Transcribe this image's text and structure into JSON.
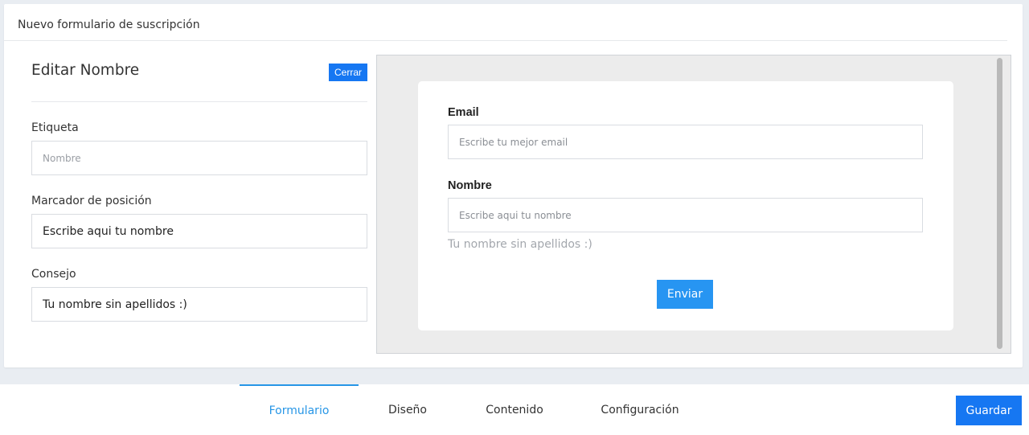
{
  "header": {
    "title": "Nuevo formulario de suscripción"
  },
  "editor": {
    "title": "Editar Nombre",
    "close_label": "Cerrar",
    "fields": [
      {
        "label": "Etiqueta",
        "value": "",
        "placeholder": "Nombre"
      },
      {
        "label": "Marcador de posición",
        "value": "Escribe aqui tu nombre",
        "placeholder": ""
      },
      {
        "label": "Consejo",
        "value": "Tu nombre sin apellidos :)",
        "placeholder": ""
      }
    ]
  },
  "preview": {
    "email_label": "Email",
    "email_placeholder": "Escribe tu mejor email",
    "name_label": "Nombre",
    "name_placeholder": "Escribe aqui tu nombre",
    "name_hint": "Tu nombre sin apellidos :)",
    "submit_label": "Enviar"
  },
  "tabs": [
    {
      "label": "Formulario",
      "active": true
    },
    {
      "label": "Diseño",
      "active": false
    },
    {
      "label": "Contenido",
      "active": false
    },
    {
      "label": "Configuración",
      "active": false
    }
  ],
  "save_label": "Guardar",
  "colors": {
    "primary": "#1677f2",
    "active_tab": "#2796e6",
    "submit": "#2795f2"
  }
}
